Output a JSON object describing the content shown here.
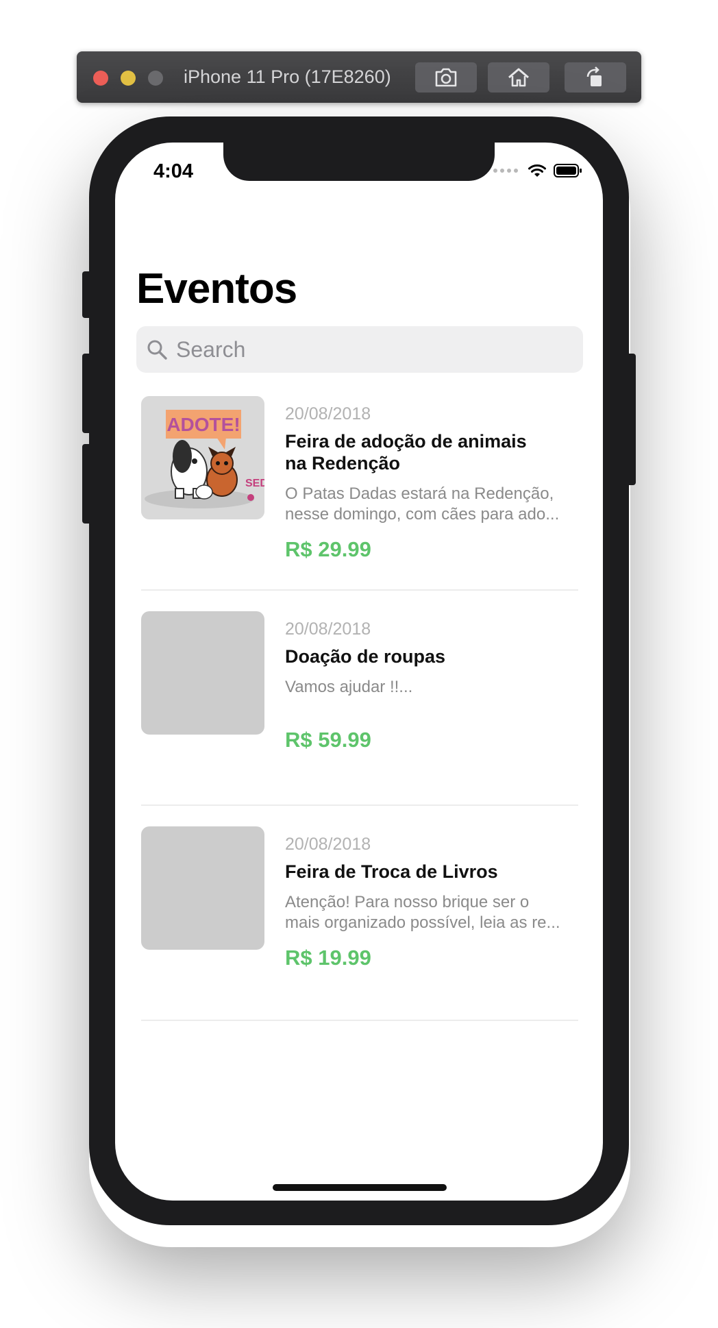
{
  "simulator": {
    "device_title": "iPhone 11 Pro (17E8260)",
    "buttons": [
      "screenshot-icon",
      "home-icon",
      "rotate-icon"
    ]
  },
  "status_bar": {
    "time": "4:04"
  },
  "page": {
    "title": "Eventos",
    "search_placeholder": "Search"
  },
  "events": [
    {
      "date": "20/08/2018",
      "title": "Feira de adoção de animais na Redenção",
      "description_lines": [
        "O Patas Dadas estará na Redenção,",
        "nesse domingo, com cães para ado..."
      ],
      "price": "R$ 29.99",
      "image": {
        "text": "ADOTE!",
        "secondary_text": "SEDA",
        "has_image": true
      }
    },
    {
      "date": "20/08/2018",
      "title": "Doação de roupas",
      "description_lines": [
        "Vamos ajudar !!..."
      ],
      "price": "R$ 59.99",
      "image": {
        "has_image": false
      }
    },
    {
      "date": "20/08/2018",
      "title": "Feira de Troca de Livros",
      "description_lines": [
        "Atenção! Para nosso brique ser o",
        "mais organizado possível, leia as re..."
      ],
      "price": "R$ 19.99",
      "image": {
        "has_image": false
      }
    }
  ],
  "colors": {
    "price": "#5ec46b",
    "thumb_placeholder": "#cccccc",
    "date": "#b2b2b2"
  }
}
